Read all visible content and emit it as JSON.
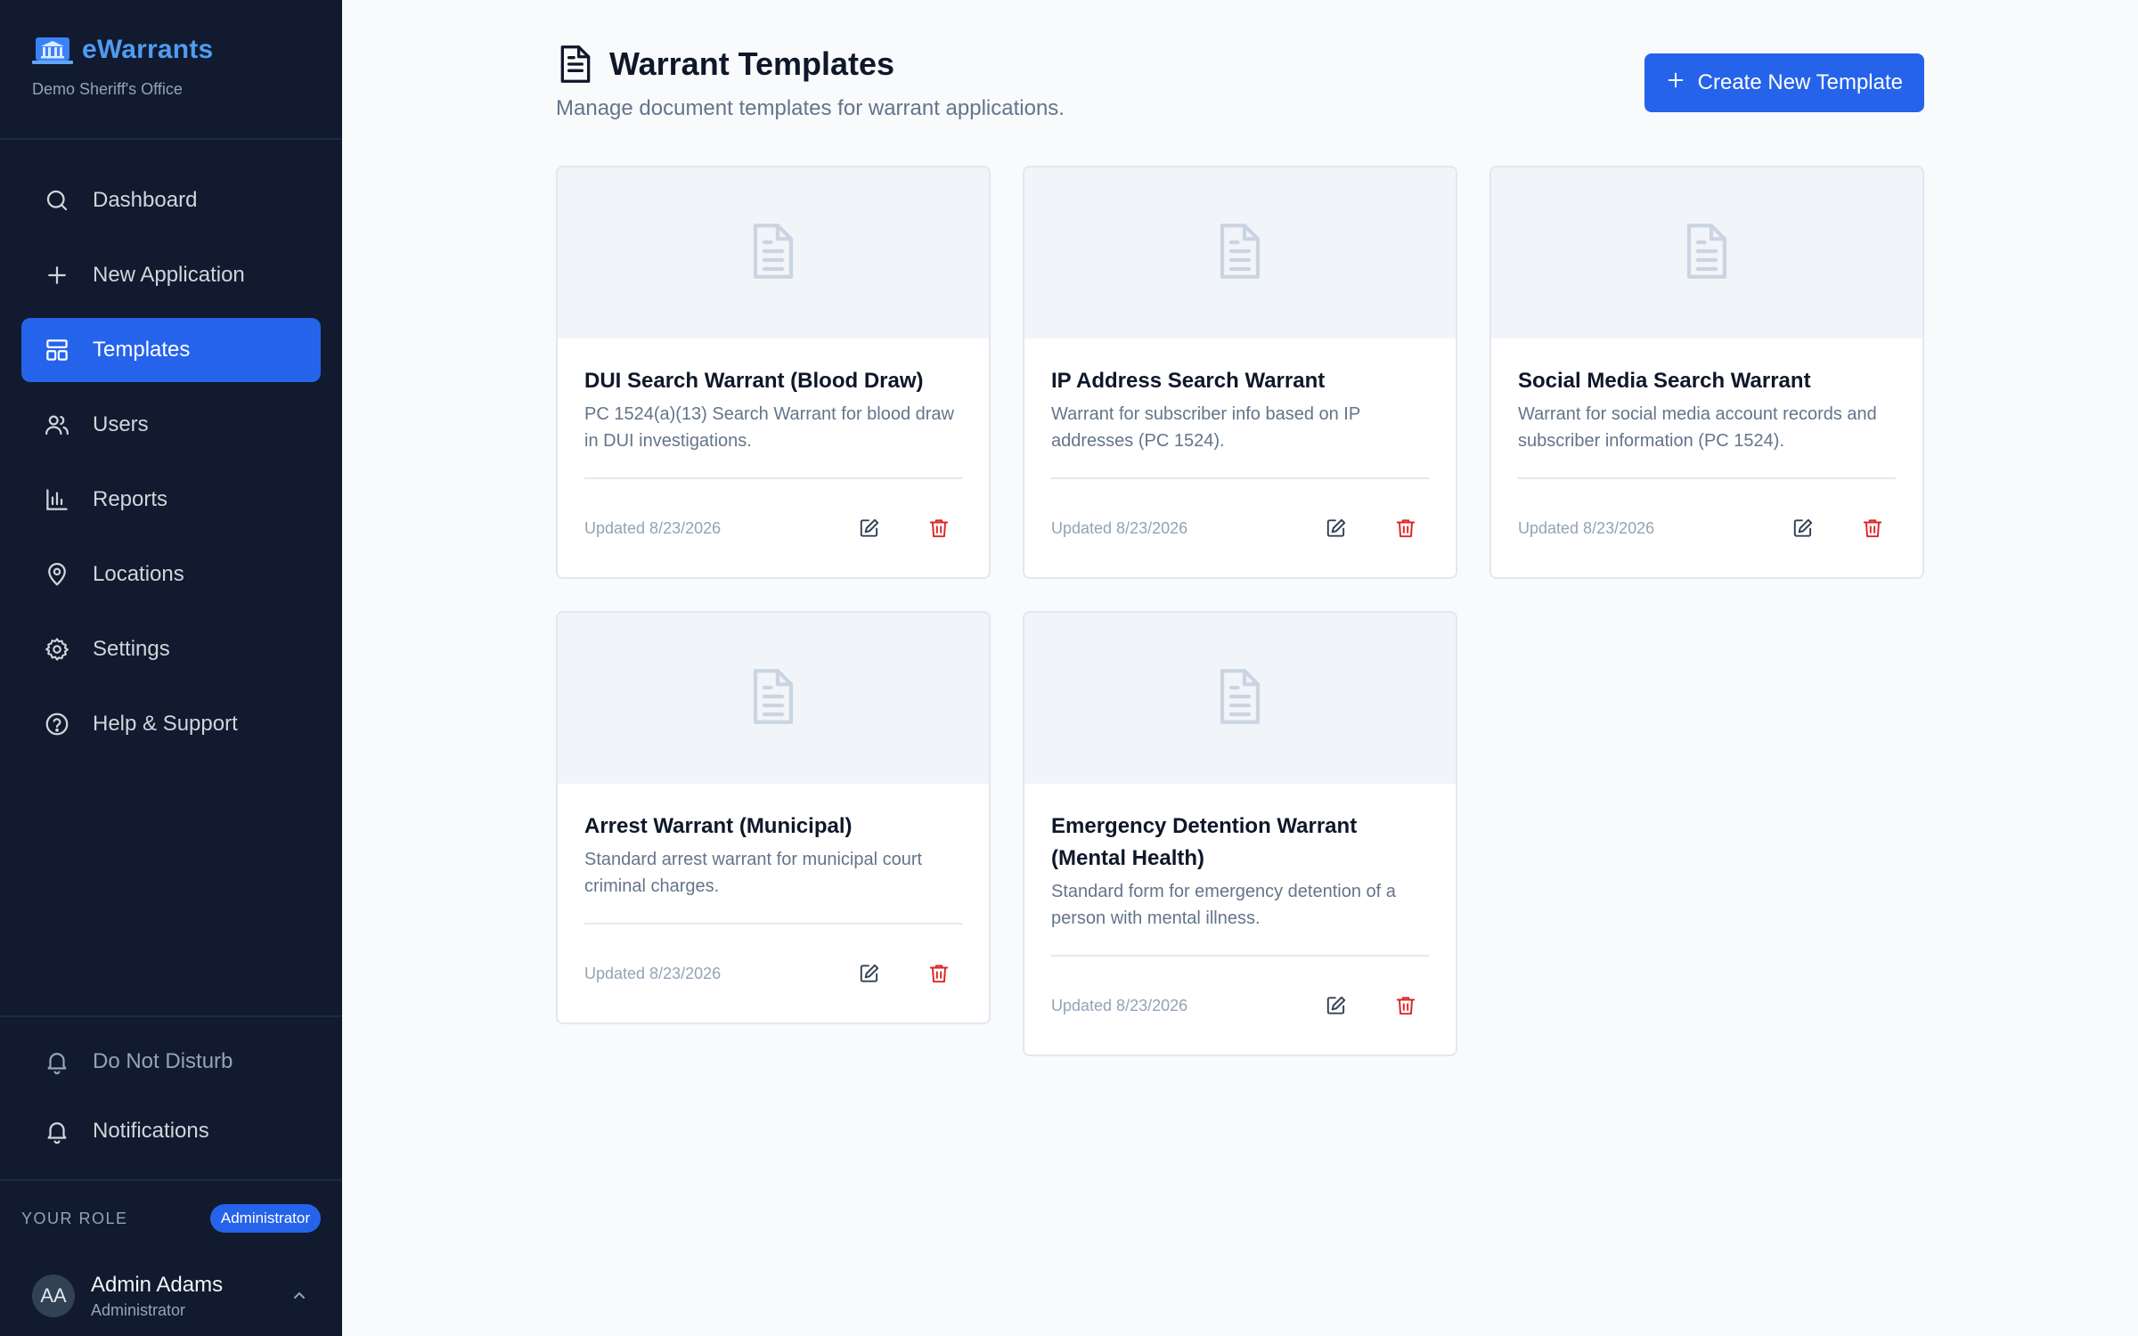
{
  "brand": {
    "name": "eWarrants",
    "subtitle": "Demo Sheriff's Office"
  },
  "nav": {
    "items": [
      {
        "label": "Dashboard",
        "icon": "search-icon"
      },
      {
        "label": "New Application",
        "icon": "plus-icon"
      },
      {
        "label": "Templates",
        "icon": "layout-icon",
        "active": true
      },
      {
        "label": "Users",
        "icon": "users-icon"
      },
      {
        "label": "Reports",
        "icon": "bar-chart-icon"
      },
      {
        "label": "Locations",
        "icon": "map-pin-icon"
      },
      {
        "label": "Settings",
        "icon": "gear-icon"
      },
      {
        "label": "Help & Support",
        "icon": "help-circle-icon"
      }
    ]
  },
  "bottom_nav": {
    "dnd_label": "Do Not Disturb",
    "notifications_label": "Notifications"
  },
  "role": {
    "label": "YOUR ROLE",
    "badge": "Administrator"
  },
  "user": {
    "initials": "AA",
    "name": "Admin Adams",
    "role": "Administrator"
  },
  "header": {
    "title": "Warrant Templates",
    "subtitle": "Manage document templates for warrant applications.",
    "create_label": "Create New Template"
  },
  "templates": [
    {
      "title": "DUI Search Warrant (Blood Draw)",
      "description": "PC 1524(a)(13) Search Warrant for blood draw in DUI investigations.",
      "updated": "Updated 8/23/2026"
    },
    {
      "title": "IP Address Search Warrant",
      "description": "Warrant for subscriber info based on IP addresses (PC 1524).",
      "updated": "Updated 8/23/2026"
    },
    {
      "title": "Social Media Search Warrant",
      "description": "Warrant for social media account records and subscriber information (PC 1524).",
      "updated": "Updated 8/23/2026"
    },
    {
      "title": "Arrest Warrant (Municipal)",
      "description": "Standard arrest warrant for municipal court criminal charges.",
      "updated": "Updated 8/23/2026"
    },
    {
      "title": "Emergency Detention Warrant (Mental Health)",
      "description": "Standard form for emergency detention of a person with mental illness.",
      "updated": "Updated 8/23/2026"
    }
  ],
  "colors": {
    "accent": "#2563eb",
    "sidebar": "#111a2e",
    "danger": "#dc2626",
    "brand": "#4f9cf2"
  }
}
